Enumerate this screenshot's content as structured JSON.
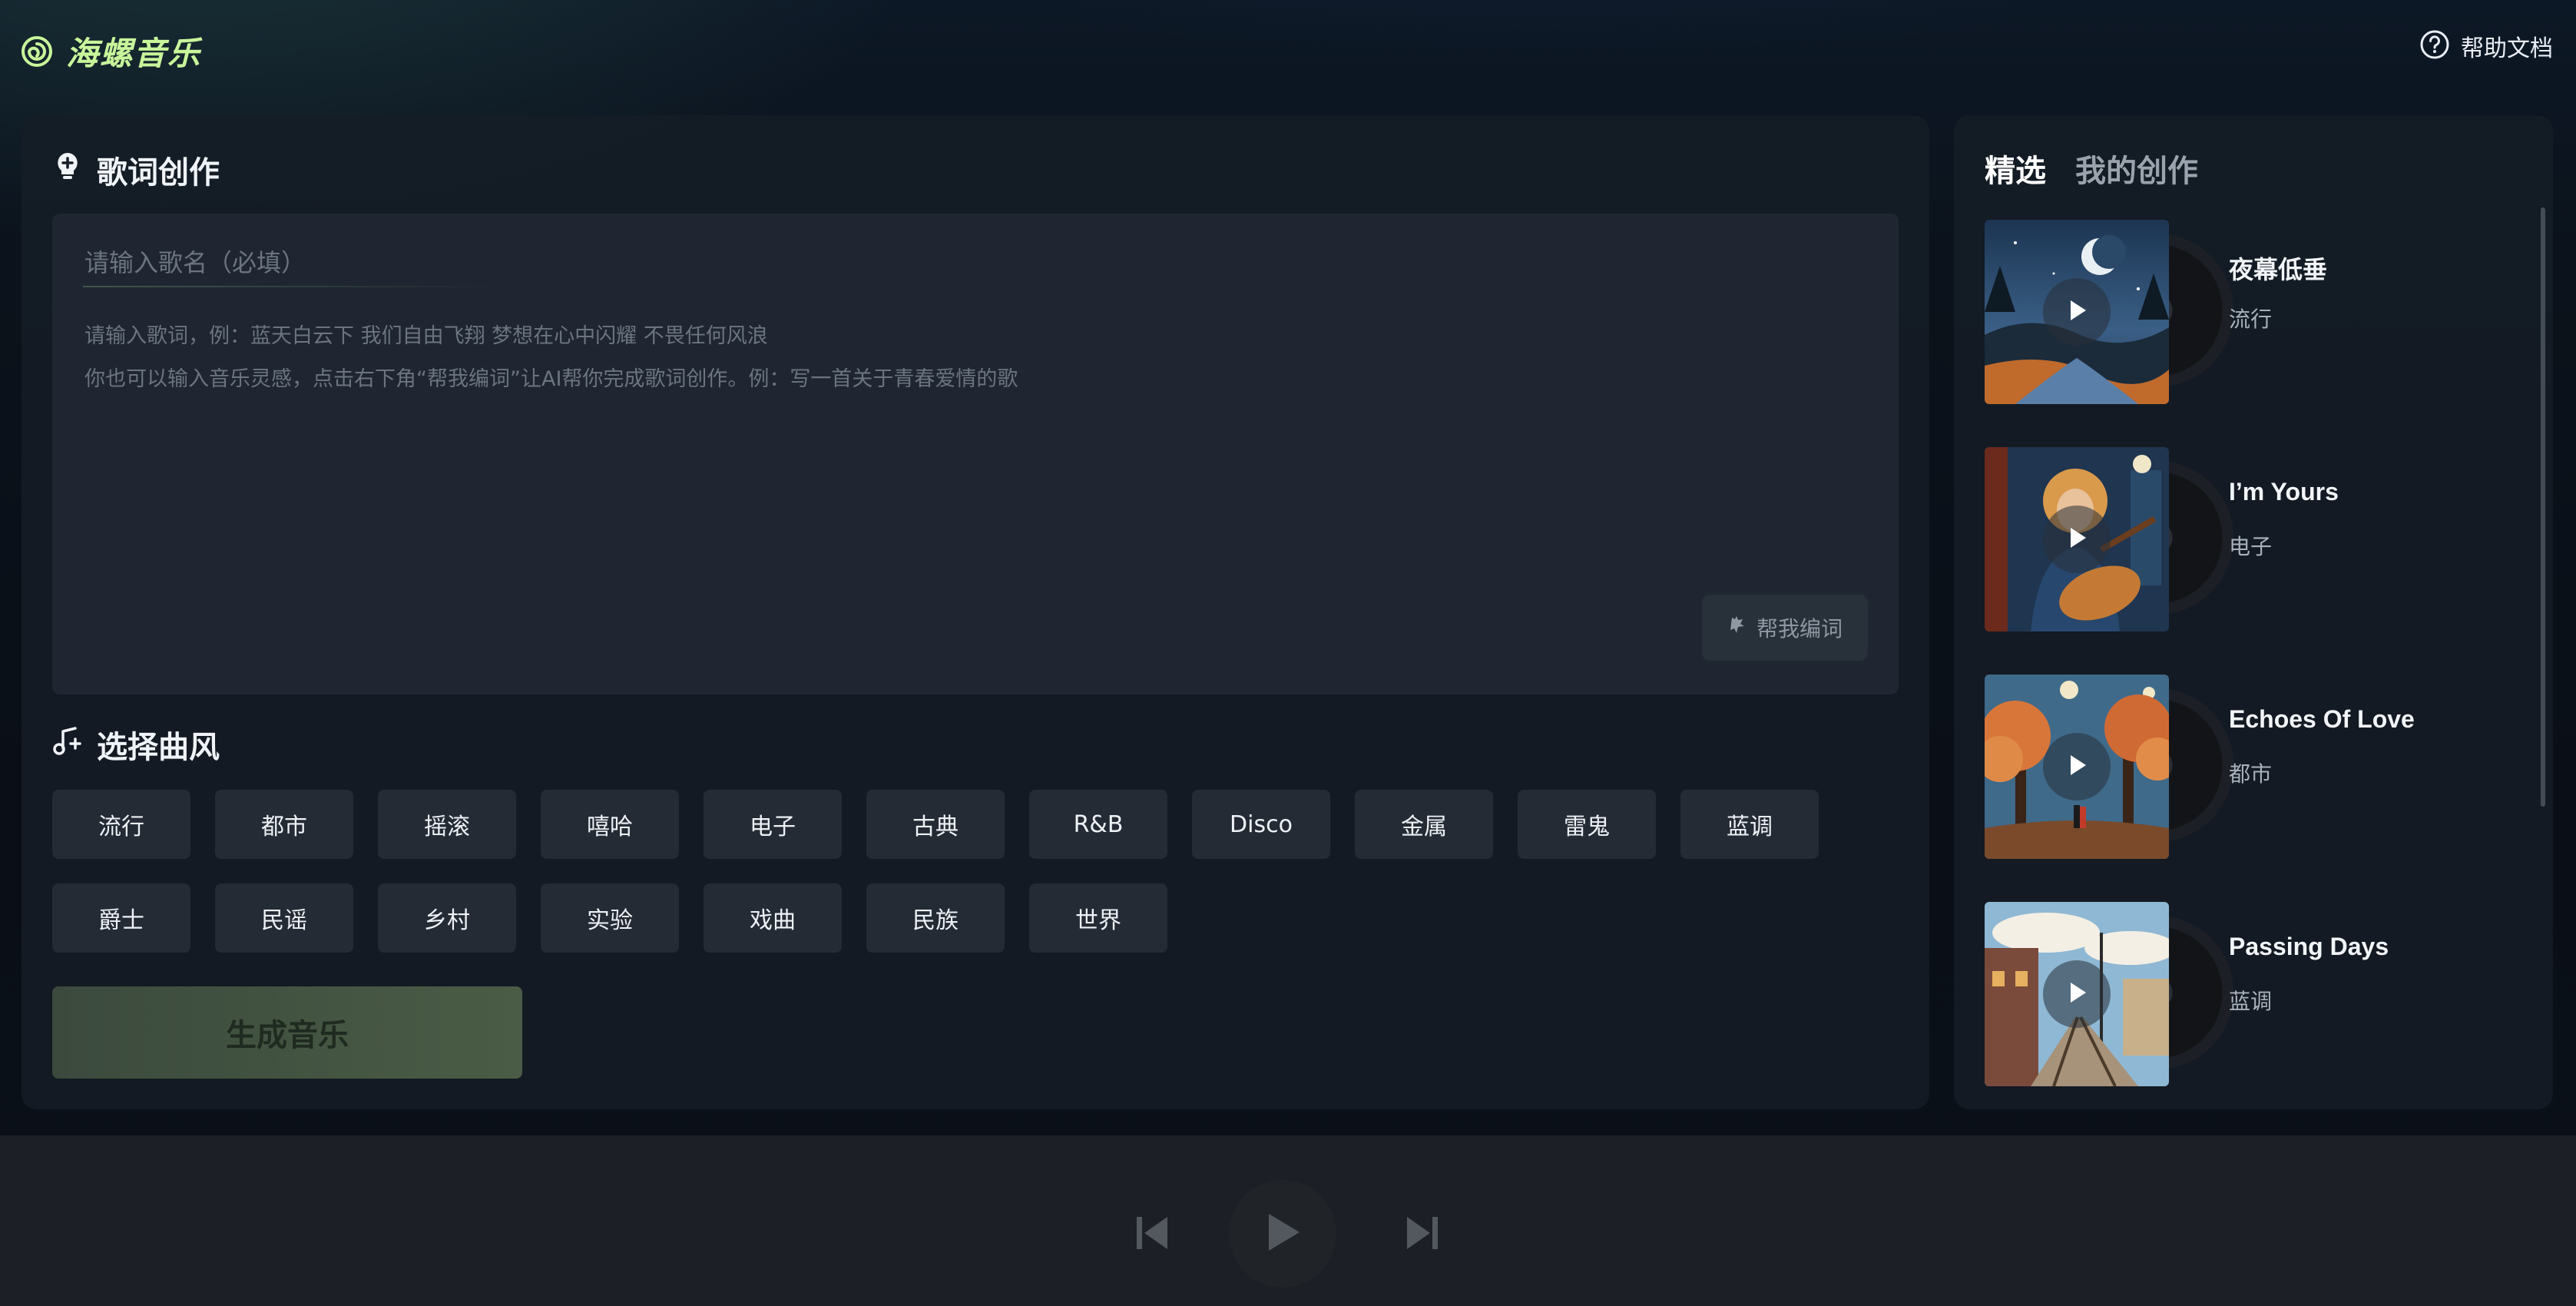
{
  "app": {
    "name": "海螺音乐"
  },
  "header": {
    "help_label": "帮助文档"
  },
  "lyrics_section": {
    "title": "歌词创作",
    "song_name_placeholder": "请输入歌名（必填）",
    "lyrics_placeholder": "请输入歌词，例：蓝天白云下 我们自由飞翔 梦想在心中闪耀 不畏任何风浪\n你也可以输入音乐灵感，点击右下角“帮我编词”让AI帮你完成歌词创作。例：写一首关于青春爱情的歌",
    "help_write_label": "帮我编词"
  },
  "genre_section": {
    "title": "选择曲风",
    "genres": [
      "流行",
      "都市",
      "摇滚",
      "嘻哈",
      "电子",
      "古典",
      "R&B",
      "Disco",
      "金属",
      "雷鬼",
      "蓝调",
      "爵士",
      "民谣",
      "乡村",
      "实验",
      "戏曲",
      "民族",
      "世界"
    ]
  },
  "generate_label": "生成音乐",
  "sidebar": {
    "tabs": [
      {
        "label": "精选",
        "active": true
      },
      {
        "label": "我的创作",
        "active": false
      }
    ],
    "items": [
      {
        "title": "夜幕低垂",
        "genre": "流行"
      },
      {
        "title": "I’m Yours",
        "genre": "电子"
      },
      {
        "title": "Echoes Of Love",
        "genre": "都市"
      },
      {
        "title": "Passing Days",
        "genre": "蓝调"
      }
    ]
  },
  "icons": {
    "logo": "snail-logo-icon",
    "help": "question-circle-icon",
    "lyrics": "lightbulb-plus-icon",
    "genre": "music-note-plus-icon",
    "help_write": "sparkle-hand-icon",
    "prev": "skip-previous-icon",
    "play": "play-icon",
    "next": "skip-next-icon"
  },
  "colors": {
    "accent": "#c9f59a",
    "panel": "#161d27",
    "generate": "#4a5c45"
  }
}
